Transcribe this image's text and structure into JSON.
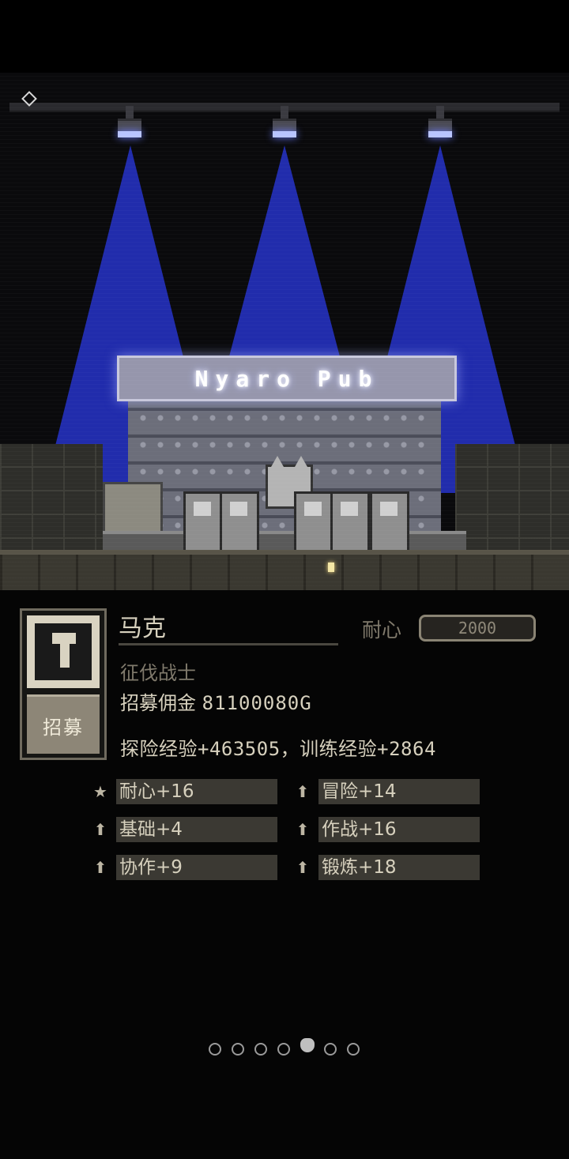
{
  "scene": {
    "pub_sign": "Nyaro Pub",
    "beam_color": "#2b3bd8",
    "sign_color": "#9696ac"
  },
  "hero": {
    "name": "马克",
    "class": "征伐战士",
    "fee_label": "招募佣金",
    "fee_value": "81100080G",
    "exp_text": "探险经验+463505，训练经验+2864",
    "patience_label": "耐心",
    "patience_value": "2000",
    "recruit_label": "招募",
    "portrait_icon": "knight-helmet-icon"
  },
  "stats": [
    {
      "icon": "star-icon",
      "text": "耐心+16"
    },
    {
      "icon": "arrow-up-icon",
      "text": "冒险+14"
    },
    {
      "icon": "arrow-up-icon",
      "text": "基础+4"
    },
    {
      "icon": "arrow-up-icon",
      "text": "作战+16"
    },
    {
      "icon": "arrow-up-icon",
      "text": "协作+9"
    },
    {
      "icon": "arrow-up-icon",
      "text": "锻炼+18"
    }
  ],
  "pager": {
    "count": 7,
    "active_index": 4
  },
  "colors": {
    "panel_bg": "#050505",
    "text": "#d7d1be",
    "muted": "#807a6c",
    "stat_box": "#3b3933"
  }
}
